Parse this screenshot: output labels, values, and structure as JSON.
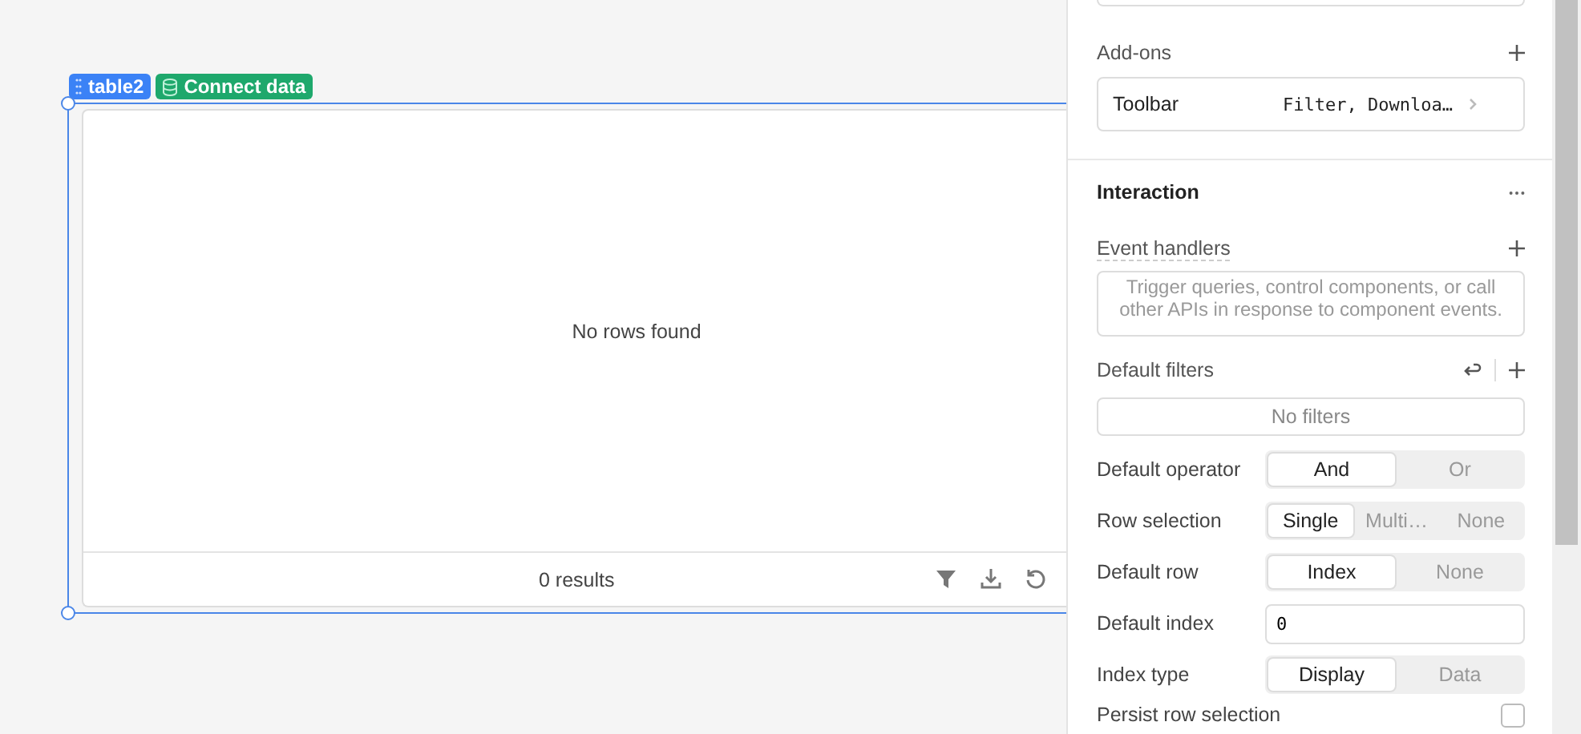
{
  "canvas": {
    "component_badge": "table2",
    "connect_badge": "Connect data",
    "table": {
      "empty_message": "No rows found",
      "results": "0 results"
    }
  },
  "inspector": {
    "addons": {
      "title": "Add-ons",
      "items": [
        {
          "label": "Toolbar",
          "value": "Filter, Downloa…"
        }
      ]
    },
    "interaction": {
      "title": "Interaction",
      "event_handlers": {
        "label": "Event handlers",
        "placeholder": "Trigger queries, control components, or call other APIs in response to component events."
      },
      "default_filters": {
        "label": "Default filters",
        "empty": "No filters"
      },
      "settings": [
        {
          "kind": "segmented",
          "label": "Default operator",
          "options": [
            {
              "label": "And",
              "selected": true
            },
            {
              "label": "Or",
              "selected": false
            }
          ]
        },
        {
          "kind": "segmented",
          "label": "Row selection",
          "options": [
            {
              "label": "Single",
              "selected": true
            },
            {
              "label": "Multi…",
              "selected": false
            },
            {
              "label": "None",
              "selected": false
            }
          ]
        },
        {
          "kind": "segmented",
          "label": "Default row",
          "options": [
            {
              "label": "Index",
              "selected": true
            },
            {
              "label": "None",
              "selected": false
            }
          ]
        },
        {
          "kind": "input",
          "label": "Default index",
          "value": "0"
        },
        {
          "kind": "segmented",
          "label": "Index type",
          "options": [
            {
              "label": "Display",
              "selected": true
            },
            {
              "label": "Data",
              "selected": false
            }
          ]
        },
        {
          "kind": "checkbox",
          "label": "Persist row selection",
          "checked": false
        }
      ]
    }
  }
}
